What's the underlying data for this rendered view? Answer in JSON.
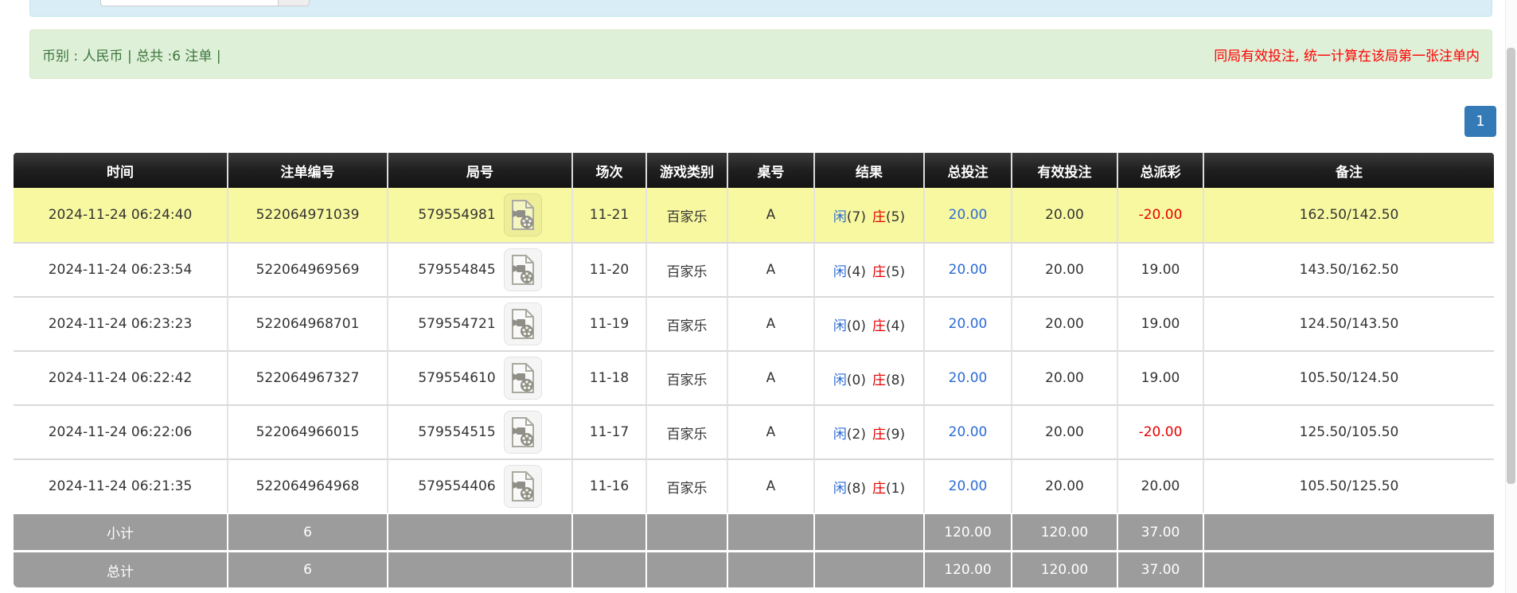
{
  "top_bar": {
    "input_value": ""
  },
  "summary_bar": {
    "left_text": "币别 : 人民币 | 总共 :6 注单 |",
    "right_note": "同局有效投注, 统一计算在该局第一张注单内"
  },
  "pagination": {
    "pages": [
      "1"
    ],
    "active": "1"
  },
  "icons": {
    "round_video": "video-replay-icon"
  },
  "colors": {
    "header_bg": "#1c1c1c",
    "highlight_row": "#f8f8a0",
    "footer_bg": "#9c9c9c",
    "link_blue": "#2b6bd3",
    "player_blue": "#2b6bd3",
    "banker_red": "#e60000",
    "negative_red": "#e60000",
    "alert_bg": "#dff0d8",
    "alert_text": "#3c763d",
    "note_red": "#ff0000",
    "pagination_blue": "#337ab7"
  },
  "table": {
    "columns": [
      "时间",
      "注单编号",
      "局号",
      "场次",
      "游戏类别",
      "桌号",
      "结果",
      "总投注",
      "有效投注",
      "总派彩",
      "备注"
    ],
    "rows": [
      {
        "time": "2024-11-24 06:24:40",
        "bet_id": "522064971039",
        "round_id": "579554981",
        "session": "11-21",
        "game": "百家乐",
        "table_code": "A",
        "player_label": "闲",
        "player_score": "(7)",
        "banker_label": "庄",
        "banker_score": "(5)",
        "total_bet": "20.00",
        "valid_bet": "20.00",
        "payout": "-20.00",
        "payout_negative": true,
        "remark": "162.50/142.50",
        "highlight": true
      },
      {
        "time": "2024-11-24 06:23:54",
        "bet_id": "522064969569",
        "round_id": "579554845",
        "session": "11-20",
        "game": "百家乐",
        "table_code": "A",
        "player_label": "闲",
        "player_score": "(4)",
        "banker_label": "庄",
        "banker_score": "(5)",
        "total_bet": "20.00",
        "valid_bet": "20.00",
        "payout": "19.00",
        "payout_negative": false,
        "remark": "143.50/162.50",
        "highlight": false
      },
      {
        "time": "2024-11-24 06:23:23",
        "bet_id": "522064968701",
        "round_id": "579554721",
        "session": "11-19",
        "game": "百家乐",
        "table_code": "A",
        "player_label": "闲",
        "player_score": "(0)",
        "banker_label": "庄",
        "banker_score": "(4)",
        "total_bet": "20.00",
        "valid_bet": "20.00",
        "payout": "19.00",
        "payout_negative": false,
        "remark": "124.50/143.50",
        "highlight": false
      },
      {
        "time": "2024-11-24 06:22:42",
        "bet_id": "522064967327",
        "round_id": "579554610",
        "session": "11-18",
        "game": "百家乐",
        "table_code": "A",
        "player_label": "闲",
        "player_score": "(0)",
        "banker_label": "庄",
        "banker_score": "(8)",
        "total_bet": "20.00",
        "valid_bet": "20.00",
        "payout": "19.00",
        "payout_negative": false,
        "remark": "105.50/124.50",
        "highlight": false
      },
      {
        "time": "2024-11-24 06:22:06",
        "bet_id": "522064966015",
        "round_id": "579554515",
        "session": "11-17",
        "game": "百家乐",
        "table_code": "A",
        "player_label": "闲",
        "player_score": "(2)",
        "banker_label": "庄",
        "banker_score": "(9)",
        "total_bet": "20.00",
        "valid_bet": "20.00",
        "payout": "-20.00",
        "payout_negative": true,
        "remark": "125.50/105.50",
        "highlight": false
      },
      {
        "time": "2024-11-24 06:21:35",
        "bet_id": "522064964968",
        "round_id": "579554406",
        "session": "11-16",
        "game": "百家乐",
        "table_code": "A",
        "player_label": "闲",
        "player_score": "(8)",
        "banker_label": "庄",
        "banker_score": "(1)",
        "total_bet": "20.00",
        "valid_bet": "20.00",
        "payout": "20.00",
        "payout_negative": false,
        "remark": "105.50/125.50",
        "highlight": false
      }
    ],
    "footer": [
      {
        "label": "小计",
        "count": "6",
        "total_bet": "120.00",
        "valid_bet": "120.00",
        "payout": "37.00"
      },
      {
        "label": "总计",
        "count": "6",
        "total_bet": "120.00",
        "valid_bet": "120.00",
        "payout": "37.00"
      }
    ]
  }
}
